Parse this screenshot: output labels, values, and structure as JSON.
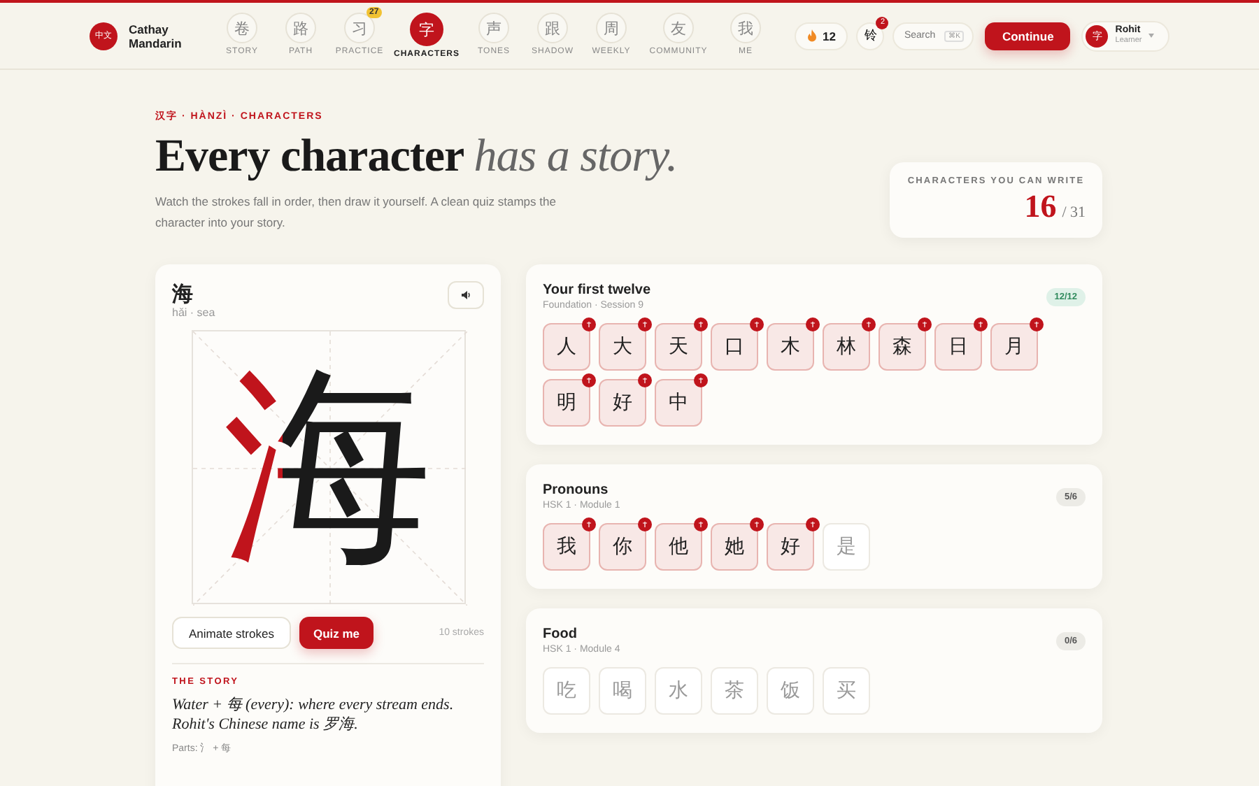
{
  "brand": {
    "logo": "中文",
    "name": "Cathay Mandarin"
  },
  "nav": [
    {
      "glyph": "卷",
      "label": "STORY",
      "selected": false
    },
    {
      "glyph": "路",
      "label": "PATH",
      "selected": false
    },
    {
      "glyph": "习",
      "label": "PRACTICE",
      "selected": false,
      "badge": "27"
    },
    {
      "glyph": "字",
      "label": "CHARACTERS",
      "selected": true
    },
    {
      "glyph": "声",
      "label": "TONES",
      "selected": false
    },
    {
      "glyph": "跟",
      "label": "SHADOW",
      "selected": false
    },
    {
      "glyph": "周",
      "label": "WEEKLY",
      "selected": false
    },
    {
      "glyph": "友",
      "label": "COMMUNITY",
      "selected": false
    },
    {
      "glyph": "我",
      "label": "ME",
      "selected": false
    }
  ],
  "streak": "12",
  "bell": {
    "glyph": "铃",
    "badge": "2"
  },
  "search": {
    "placeholder": "Search",
    "shortcut": "⌘K"
  },
  "continue_button": "Continue",
  "user": {
    "avatar": "字",
    "name": "Rohit",
    "role": "Learner"
  },
  "hero": {
    "eyebrow": "汉字 · HÀNZÌ · CHARACTERS",
    "title": "Every character *has a story.*",
    "subtitle": "Watch the strokes fall in order, then draw it yourself. A clean quiz stamps the character into your story."
  },
  "stat": {
    "label": "CHARACTERS YOU CAN WRITE",
    "value": "16",
    "total": "/ 31"
  },
  "character": {
    "glyph": "海",
    "grid_glyph": "海",
    "reading": "hǎi · sea",
    "animate_button": "Animate strokes",
    "quiz_button": "Quiz me",
    "strokes": "10 strokes",
    "story_heading": "THE STORY",
    "story": "Water + 每 (every): where every stream ends. Rohit's Chinese name is 罗海.",
    "parts": "Parts: 氵 + 每"
  },
  "decks": [
    {
      "title": "Your first twelve",
      "subtitle": "Foundation · Session 9",
      "count": "12/12",
      "complete": true,
      "tiles": [
        {
          "glyph": "人",
          "mastered": true
        },
        {
          "glyph": "大",
          "mastered": true
        },
        {
          "glyph": "天",
          "mastered": true
        },
        {
          "glyph": "口",
          "mastered": true
        },
        {
          "glyph": "木",
          "mastered": true
        },
        {
          "glyph": "林",
          "mastered": true
        },
        {
          "glyph": "森",
          "mastered": true
        },
        {
          "glyph": "日",
          "mastered": true
        },
        {
          "glyph": "月",
          "mastered": true
        },
        {
          "glyph": "明",
          "mastered": true
        },
        {
          "glyph": "好",
          "mastered": true
        },
        {
          "glyph": "中",
          "mastered": true
        }
      ]
    },
    {
      "title": "Pronouns",
      "subtitle": "HSK 1 · Module 1",
      "count": "5/6",
      "complete": false,
      "tiles": [
        {
          "glyph": "我",
          "mastered": true
        },
        {
          "glyph": "你",
          "mastered": true
        },
        {
          "glyph": "他",
          "mastered": true
        },
        {
          "glyph": "她",
          "mastered": true
        },
        {
          "glyph": "好",
          "mastered": true
        },
        {
          "glyph": "是",
          "mastered": false
        }
      ]
    },
    {
      "title": "Food",
      "subtitle": "HSK 1 · Module 4",
      "count": "0/6",
      "complete": false,
      "tiles": [
        {
          "glyph": "吃",
          "mastered": false
        },
        {
          "glyph": "喝",
          "mastered": false
        },
        {
          "glyph": "水",
          "mastered": false
        },
        {
          "glyph": "茶",
          "mastered": false
        },
        {
          "glyph": "饭",
          "mastered": false
        },
        {
          "glyph": "买",
          "mastered": false
        }
      ]
    }
  ]
}
